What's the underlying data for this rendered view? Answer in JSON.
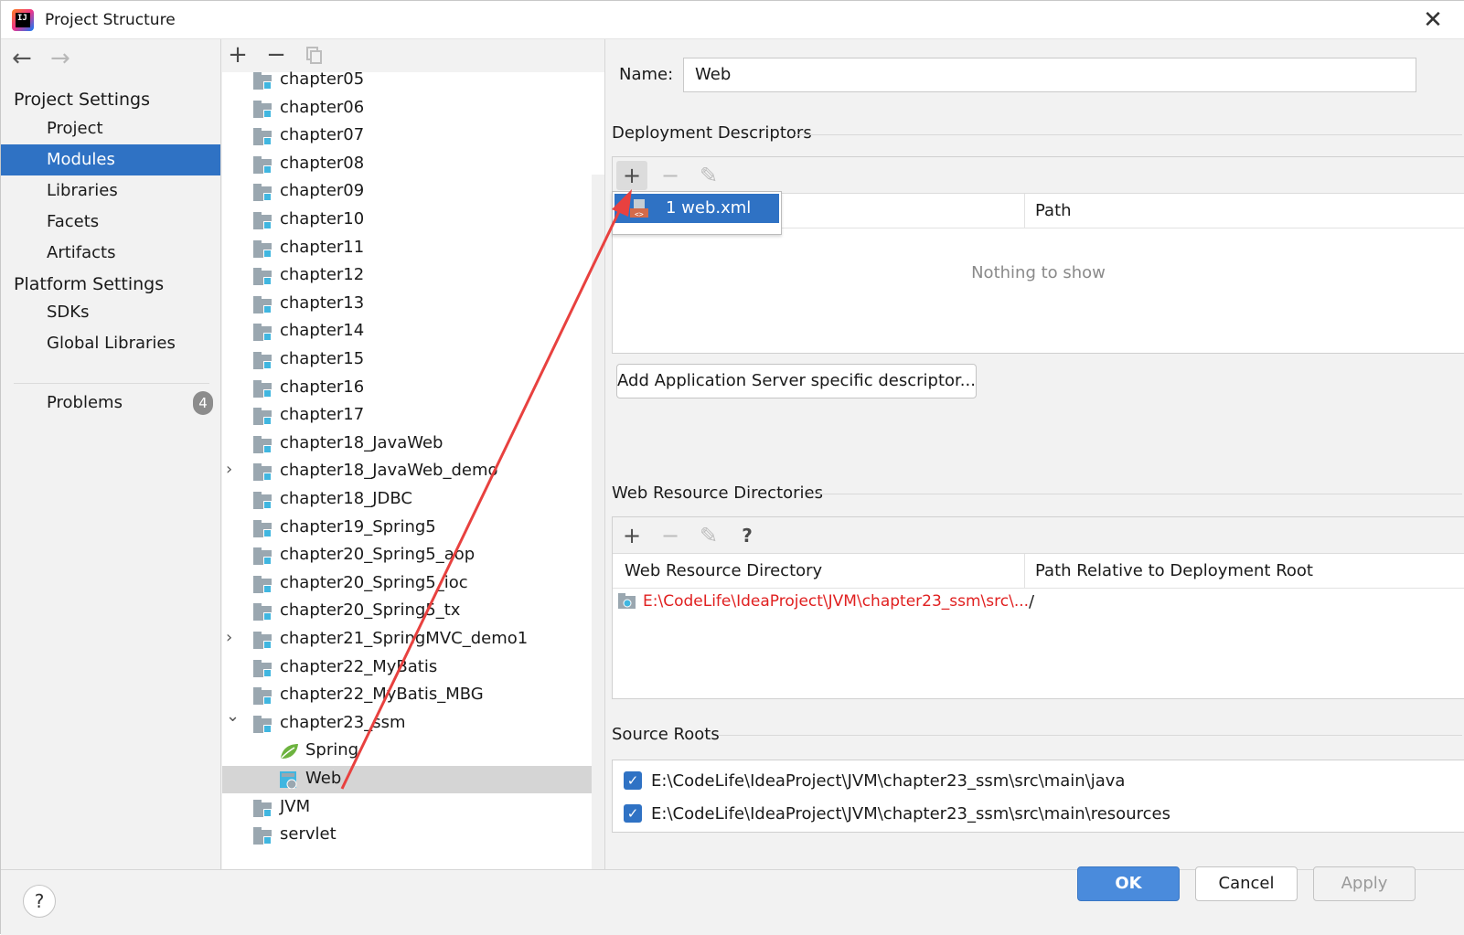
{
  "window": {
    "title": "Project Structure",
    "close": "✕"
  },
  "nav": {
    "back": "←",
    "forward": "→",
    "project_settings": "Project Settings",
    "items_project": [
      {
        "label": "Project"
      },
      {
        "label": "Modules",
        "selected": true
      },
      {
        "label": "Libraries"
      },
      {
        "label": "Facets"
      },
      {
        "label": "Artifacts"
      }
    ],
    "platform_settings": "Platform Settings",
    "items_platform": [
      {
        "label": "SDKs"
      },
      {
        "label": "Global Libraries"
      }
    ],
    "problems": "Problems",
    "problems_count": "4"
  },
  "tree": {
    "add": "+",
    "remove": "−",
    "rows": [
      {
        "label": "chapter05"
      },
      {
        "label": "chapter06"
      },
      {
        "label": "chapter07"
      },
      {
        "label": "chapter08"
      },
      {
        "label": "chapter09"
      },
      {
        "label": "chapter10"
      },
      {
        "label": "chapter11"
      },
      {
        "label": "chapter12"
      },
      {
        "label": "chapter13"
      },
      {
        "label": "chapter14"
      },
      {
        "label": "chapter15"
      },
      {
        "label": "chapter16"
      },
      {
        "label": "chapter17"
      },
      {
        "label": "chapter18_JavaWeb"
      },
      {
        "label": "chapter18_JavaWeb_demo"
      },
      {
        "label": "chapter18_JDBC"
      },
      {
        "label": "chapter19_Spring5"
      },
      {
        "label": "chapter20_Spring5_aop"
      },
      {
        "label": "chapter20_Spring5_ioc"
      },
      {
        "label": "chapter20_Spring5_tx"
      },
      {
        "label": "chapter21_SpringMVC_demo1"
      },
      {
        "label": "chapter22_MyBatis"
      },
      {
        "label": "chapter22_MyBatis_MBG"
      },
      {
        "label": "chapter23_ssm"
      },
      {
        "label": "Spring"
      },
      {
        "label": "Web"
      },
      {
        "label": "JVM"
      },
      {
        "label": "servlet"
      }
    ]
  },
  "facet": {
    "name_label": "Name:",
    "name_value": "Web",
    "deployment_title": "Deployment Descriptors",
    "dd_col_path": "Path",
    "dd_empty": "Nothing to show",
    "popup_item": "1  web.xml",
    "add_server_button": "Add Application Server specific descriptor...",
    "web_res_title": "Web Resource Directories",
    "help_q": "?",
    "wr_col1": "Web Resource Directory",
    "wr_col2": "Path Relative to Deployment Root",
    "wr_row_dir": "E:\\CodeLife\\IdeaProject\\JVM\\chapter23_ssm\\src\\...",
    "wr_row_path": "/",
    "source_title": "Source Roots",
    "source_rows": [
      {
        "path": "E:\\CodeLife\\IdeaProject\\JVM\\chapter23_ssm\\src\\main\\java",
        "checked": true
      },
      {
        "path": "E:\\CodeLife\\IdeaProject\\JVM\\chapter23_ssm\\src\\main\\resources",
        "checked": true
      }
    ]
  },
  "footer": {
    "help": "?",
    "ok": "OK",
    "cancel": "Cancel",
    "apply": "Apply"
  },
  "colors": {
    "selection": "#2f72c4",
    "annotation_arrow": "#e8413f",
    "error_path": "#e02020"
  }
}
